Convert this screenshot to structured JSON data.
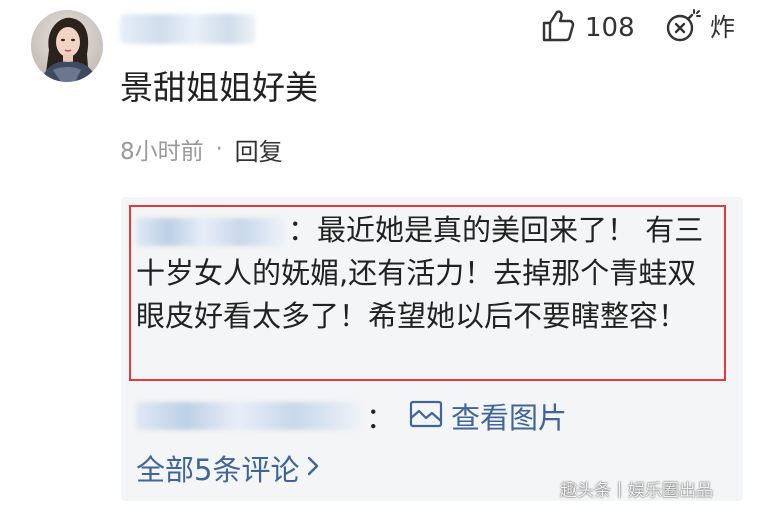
{
  "comment": {
    "text": "景甜姐姐好美",
    "time": "8小时前",
    "separator": "·",
    "reply_label": "回复",
    "like_count": "108",
    "bomb_label": "炸"
  },
  "replies": {
    "highlighted_text": "：最近她是真的美回来了！ 有三十岁女人的妩媚,还有活力！去掉那个青蛙双眼皮好看太多了！希望她以后不要瞎整容！",
    "second_colon": "：",
    "view_image_label": "查看图片",
    "all_comments_label": "全部5条评论",
    "all_comments_chevron": "›"
  },
  "watermark": "趣头条丨娱乐圈出品",
  "icons": {
    "like": "thumbs-up-icon",
    "bomb": "bomb-icon",
    "image": "image-icon",
    "chevron": "chevron-right-icon"
  },
  "colors": {
    "link": "#406599",
    "highlight_border": "#e53a3a",
    "reply_box_bg": "#f4f5f6",
    "meta_gray": "#999999"
  }
}
